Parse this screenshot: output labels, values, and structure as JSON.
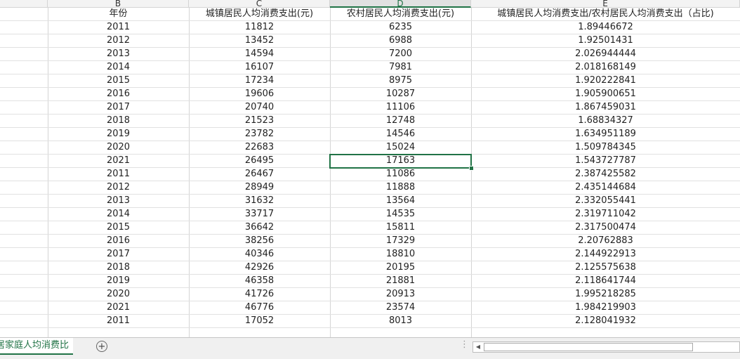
{
  "columns": [
    "B",
    "C",
    "D",
    "E"
  ],
  "selected_column": "D",
  "header_row": [
    "年份",
    "城镇居民人均消费支出(元)",
    "农村居民人均消费支出(元)",
    "城镇居民人均消费支出/农村居民人均消费支出（占比)"
  ],
  "rows": [
    [
      "2011",
      "11812",
      "6235",
      "1.89446672"
    ],
    [
      "2012",
      "13452",
      "6988",
      "1.92501431"
    ],
    [
      "2013",
      "14594",
      "7200",
      "2.026944444"
    ],
    [
      "2014",
      "16107",
      "7981",
      "2.018168149"
    ],
    [
      "2015",
      "17234",
      "8975",
      "1.920222841"
    ],
    [
      "2016",
      "19606",
      "10287",
      "1.905900651"
    ],
    [
      "2017",
      "20740",
      "11106",
      "1.867459031"
    ],
    [
      "2018",
      "21523",
      "12748",
      "1.68834327"
    ],
    [
      "2019",
      "23782",
      "14546",
      "1.634951189"
    ],
    [
      "2020",
      "22683",
      "15024",
      "1.509784345"
    ],
    [
      "2021",
      "26495",
      "17163",
      "1.543727787"
    ],
    [
      "2011",
      "26467",
      "11086",
      "2.387425582"
    ],
    [
      "2012",
      "28949",
      "11888",
      "2.435144684"
    ],
    [
      "2013",
      "31632",
      "13564",
      "2.332055441"
    ],
    [
      "2014",
      "33717",
      "14535",
      "2.319711042"
    ],
    [
      "2015",
      "36642",
      "15811",
      "2.317500474"
    ],
    [
      "2016",
      "38256",
      "17329",
      "2.20762883"
    ],
    [
      "2017",
      "40346",
      "18810",
      "2.144922913"
    ],
    [
      "2018",
      "42926",
      "20195",
      "2.125575638"
    ],
    [
      "2019",
      "46358",
      "21881",
      "2.118641744"
    ],
    [
      "2020",
      "41726",
      "20913",
      "1.995218285"
    ],
    [
      "2021",
      "46776",
      "23574",
      "1.984219903"
    ],
    [
      "2011",
      "17052",
      "8013",
      "2.128041932"
    ]
  ],
  "selected_cell": {
    "column": "D",
    "value": "17163"
  },
  "sheet_tab": {
    "label": "居家庭人均消费比"
  },
  "add_sheet_icon": "plus-circle-icon",
  "accent_color": "#217346"
}
